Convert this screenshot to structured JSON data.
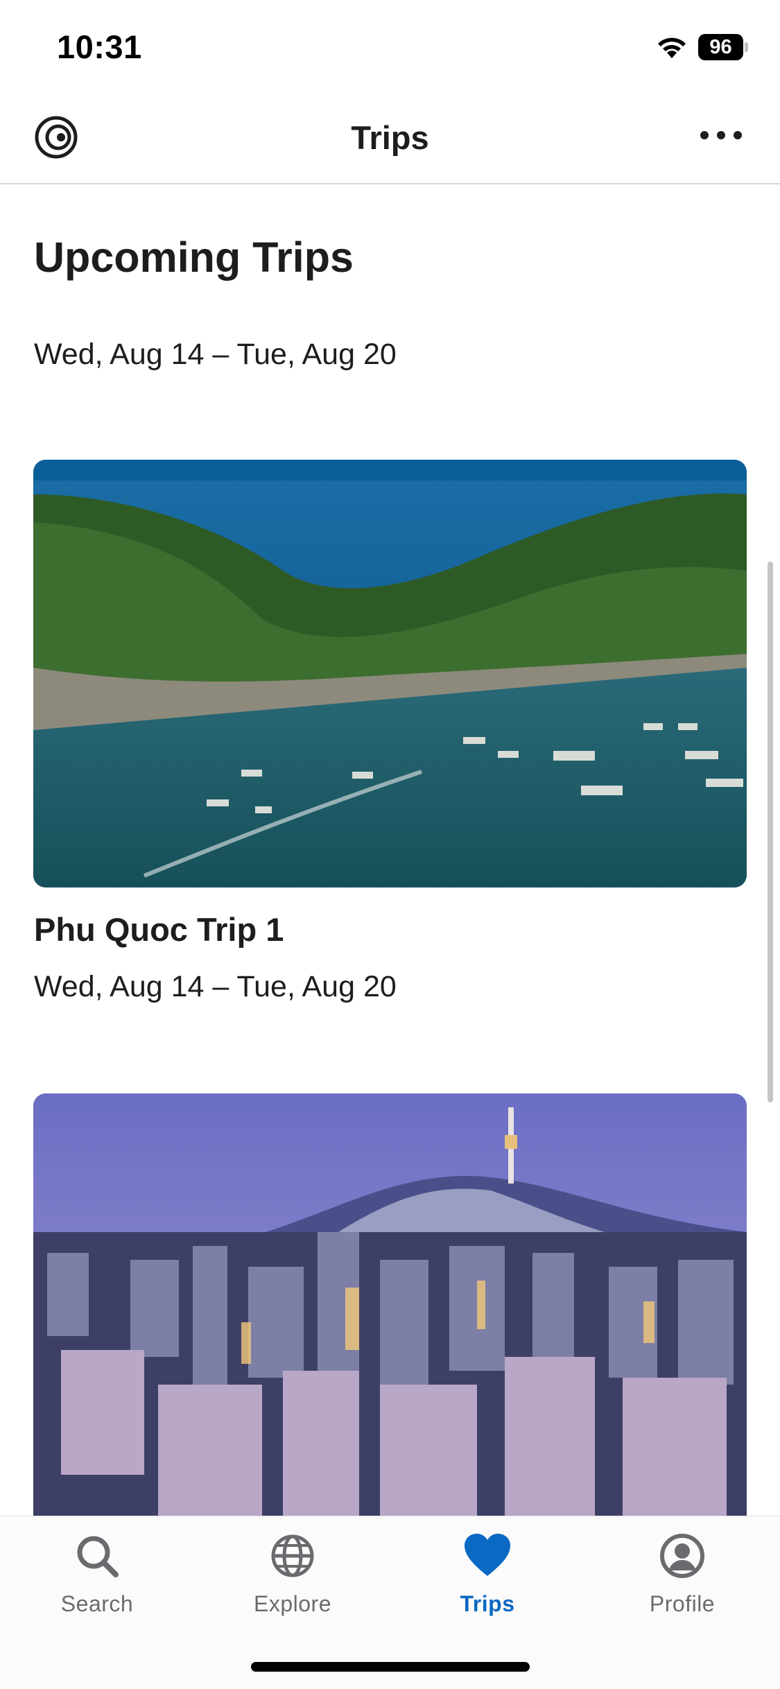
{
  "status_bar": {
    "time": "10:31",
    "battery": "96",
    "icons": [
      "wifi-icon",
      "battery-icon"
    ]
  },
  "nav_bar": {
    "title": "Trips",
    "left_icon": "brand-logo-icon",
    "right_icon": "more-icon"
  },
  "section": {
    "title": "Upcoming Trips",
    "dates": "Wed, Aug 14 – Tue, Aug 20"
  },
  "trips": [
    {
      "name": "Phu Quoc Trip 1",
      "dates": "Wed, Aug 14 – Tue, Aug 20",
      "image": "tropical island bay with boats"
    },
    {
      "name": "",
      "dates": "",
      "image": "city skyline with tower on hill at dusk"
    }
  ],
  "tab_bar": {
    "tabs": [
      {
        "label": "Search",
        "icon": "search-icon",
        "active": false
      },
      {
        "label": "Explore",
        "icon": "globe-icon",
        "active": false
      },
      {
        "label": "Trips",
        "icon": "heart-icon",
        "active": true
      },
      {
        "label": "Profile",
        "icon": "profile-icon",
        "active": false
      }
    ]
  },
  "colors": {
    "accent": "#0a69c3",
    "text": "#1d1d1f",
    "tab_inactive": "#6b6b6f"
  }
}
